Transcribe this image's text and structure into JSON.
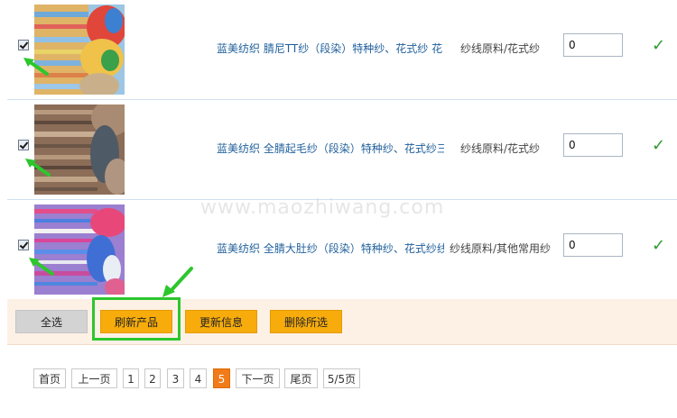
{
  "products": [
    {
      "title": "蓝美纺织 腈尼TT纱（段染）特种纱、花式纱 花",
      "category": "纱线原料/花式纱",
      "quantity": "0",
      "checked": true,
      "status_icon": "checkmark-icon"
    },
    {
      "title": "蓝美纺织 全腈起毛纱（段染）特种纱、花式纱三",
      "category": "纱线原料/花式纱",
      "quantity": "0",
      "checked": true,
      "status_icon": "checkmark-icon"
    },
    {
      "title": "蓝美纺织 全腈大肚纱（段染）特种纱、花式纱线",
      "category": "纱线原料/其他常用纱",
      "quantity": "0",
      "checked": true,
      "status_icon": "checkmark-icon"
    }
  ],
  "actions": {
    "select_all": "全选",
    "refresh": "刷新产品",
    "update": "更新信息",
    "delete": "删除所选"
  },
  "pagination": {
    "first": "首页",
    "prev": "上一页",
    "pages": [
      "1",
      "2",
      "3",
      "4",
      "5"
    ],
    "current": "5",
    "next": "下一页",
    "last": "尾页",
    "summary": "5/5页"
  },
  "watermark": "www.maozhiwang.com",
  "colors": {
    "accent_orange": "#f7ac0b",
    "highlight_green": "#2dc62d",
    "link_blue": "#1f5f9a",
    "current_page": "#f07b18"
  }
}
